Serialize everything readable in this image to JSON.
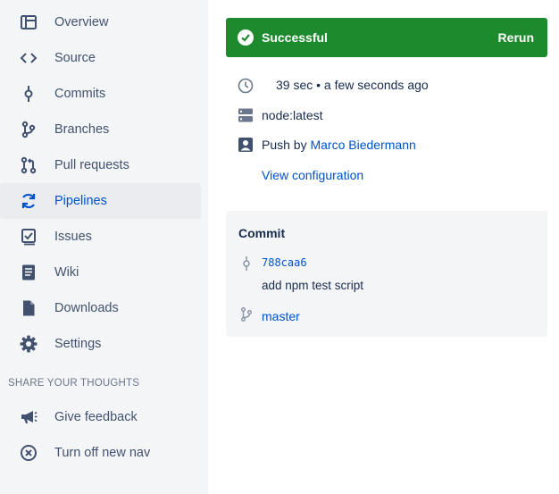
{
  "sidebar": {
    "items": [
      {
        "label": "Overview",
        "icon": "overview-icon"
      },
      {
        "label": "Source",
        "icon": "code-icon"
      },
      {
        "label": "Commits",
        "icon": "commit-icon"
      },
      {
        "label": "Branches",
        "icon": "branch-icon"
      },
      {
        "label": "Pull requests",
        "icon": "pull-request-icon"
      },
      {
        "label": "Pipelines",
        "icon": "pipelines-icon",
        "active": true
      },
      {
        "label": "Issues",
        "icon": "issues-icon"
      },
      {
        "label": "Wiki",
        "icon": "wiki-icon"
      },
      {
        "label": "Downloads",
        "icon": "file-icon"
      },
      {
        "label": "Settings",
        "icon": "gear-icon"
      }
    ],
    "section_title": "SHARE YOUR THOUGHTS",
    "feedback_items": [
      {
        "label": "Give feedback",
        "icon": "megaphone-icon"
      },
      {
        "label": "Turn off new nav",
        "icon": "close-circle-icon"
      }
    ]
  },
  "status": {
    "label": "Successful",
    "rerun_label": "Rerun",
    "color": "#1E8A2E"
  },
  "details": {
    "duration": "39 sec • a few seconds ago",
    "image": "node:latest",
    "trigger_prefix": "Push by",
    "author": "Marco Biedermann",
    "view_config": "View configuration"
  },
  "commit": {
    "title": "Commit",
    "hash": "788caa6",
    "message": "add npm test script",
    "branch": "master"
  },
  "colors": {
    "sidebar_bg": "#F4F5F7",
    "active_bg": "#EBECF0",
    "link": "#0052CC",
    "text": "#172B4D",
    "nav_text": "#42526E"
  }
}
